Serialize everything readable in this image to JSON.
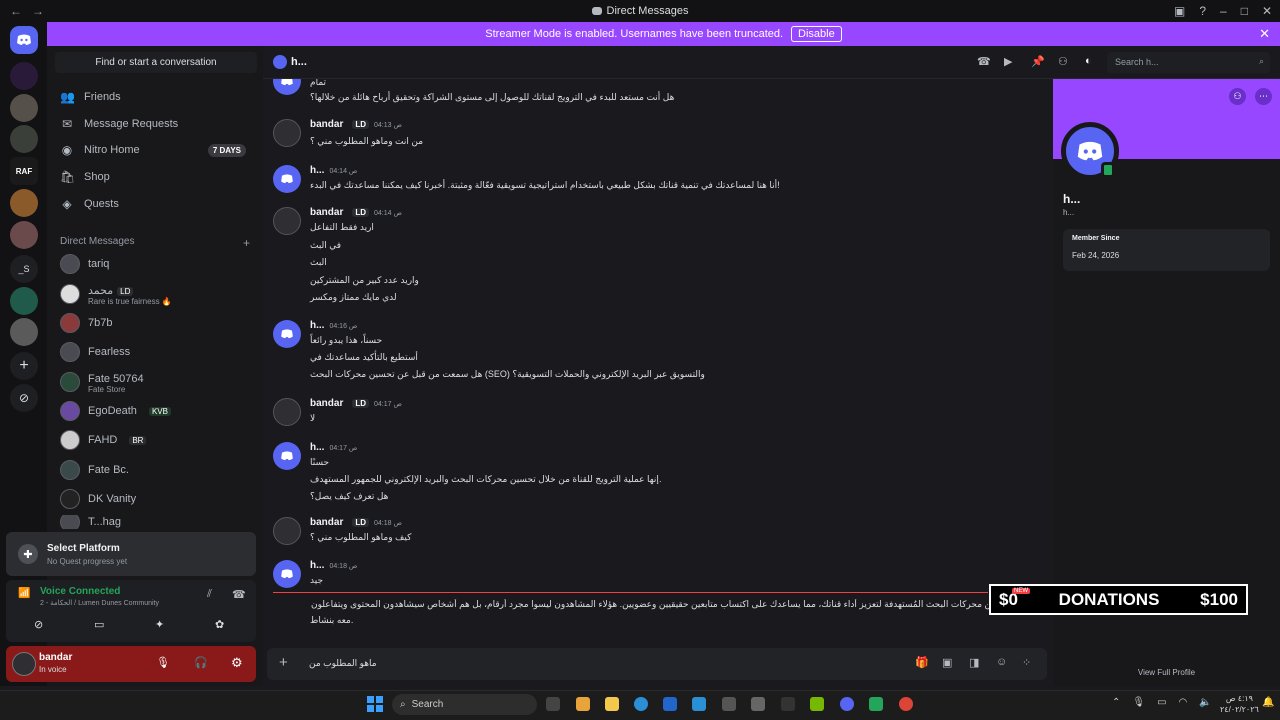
{
  "titlebar": {
    "title": "Direct Messages"
  },
  "banner": {
    "text": "Streamer Mode is enabled. Usernames have been truncated.",
    "button": "Disable"
  },
  "sidebar": {
    "find_placeholder": "Find or start a conversation",
    "nav": [
      {
        "label": "Friends",
        "icon": "friends-icon"
      },
      {
        "label": "Message Requests",
        "icon": "mail-icon"
      },
      {
        "label": "Nitro Home",
        "icon": "nitro-icon",
        "badge": "7 DAYS"
      },
      {
        "label": "Shop",
        "icon": "shop-icon"
      },
      {
        "label": "Quests",
        "icon": "quests-icon"
      }
    ],
    "dm_header": "Direct Messages",
    "dms": [
      {
        "name": "tariq",
        "sub": "",
        "tag": ""
      },
      {
        "name": "محمد",
        "sub": "Rare is true fairness 🔥",
        "tag": "LD"
      },
      {
        "name": "7b7b",
        "sub": "",
        "tag": ""
      },
      {
        "name": "Fearless",
        "sub": "",
        "tag": ""
      },
      {
        "name": "Fate 50764",
        "sub": "Fate Store",
        "tag": ""
      },
      {
        "name": "EgoDeath",
        "sub": "",
        "tag": "KVB"
      },
      {
        "name": "FAHD",
        "sub": "",
        "tag": "BR"
      },
      {
        "name": "Fate Bc.",
        "sub": "",
        "tag": ""
      },
      {
        "name": "DK Vanity",
        "sub": "",
        "tag": ""
      },
      {
        "name": "T...hag",
        "sub": "",
        "tag": ""
      }
    ]
  },
  "quest": {
    "title": "Select Platform",
    "sub": "No Quest progress yet"
  },
  "voice": {
    "status": "Voice Connected",
    "channel": "2 - الحكامة / Lumen Dunes Community"
  },
  "user": {
    "name": "bandar",
    "status": "In voice"
  },
  "chat_header": {
    "name": "h...",
    "search_placeholder": "Search h..."
  },
  "messages": [
    {
      "author": "",
      "time": "",
      "kind": "bot",
      "lines": [
        "تمام",
        "هل أنت مستعد للبدء في الترويج لقناتك للوصول إلى مستوى الشراكة وتحقيق أرباح هائلة من خلالها؟"
      ]
    },
    {
      "author": "bandar",
      "time": "04:13 ص",
      "kind": "user",
      "tag": "LD",
      "lines": [
        "من انت وماهو المطلوب مني ؟"
      ]
    },
    {
      "author": "h...",
      "time": "04:14 ص",
      "kind": "bot",
      "lines": [
        "أنا هنا لمساعدتك في تنمية قناتك بشكل طبيعي باستخدام استراتيجية تسويقية فعّالة ومثبتة. أخبرنا كيف يمكننا مساعدتك في البدء!"
      ]
    },
    {
      "author": "bandar",
      "time": "04:14 ص",
      "kind": "user",
      "tag": "LD",
      "lines": [
        "اريد فقط التفاعل",
        "في البث",
        "البث",
        "واريد عدد كبير من المشتركين",
        "لدي مايك ممتاز ومكسر"
      ]
    },
    {
      "author": "h...",
      "time": "04:16 ص",
      "kind": "bot",
      "lines": [
        "حسناً، هذا يبدو رائعاً",
        "أستطيع بالتأكيد مساعدتك في",
        "هل سمعت من قبل عن تحسين محركات البحث (SEO) والتسويق عبر البريد الإلكتروني والحملات التسويقية؟"
      ]
    },
    {
      "author": "bandar",
      "time": "04:17 ص",
      "kind": "user",
      "tag": "LD",
      "lines": [
        "لا"
      ]
    },
    {
      "author": "h...",
      "time": "04:17 ص",
      "kind": "bot",
      "lines": [
        "حسنًا",
        "إنها عملية الترويج للقناة من خلال تحسين محركات البحث والبريد الإلكتروني للجمهور المستهدف.",
        "هل تعرف كيف يصل؟"
      ]
    },
    {
      "author": "bandar",
      "time": "04:18 ص",
      "kind": "user",
      "tag": "LD",
      "lines": [
        "كيف وماهو المطلوب مني ؟"
      ]
    },
    {
      "author": "h...",
      "time": "04:18 ص",
      "kind": "bot",
      "lines": [
        "جيد",
        "نستخدم استراتيجيات تحسين محركات البحث المُستهدفة لتعزيز أداء قناتك، مما يساعدك على اكتساب متابعين حقيقيين وعضويين. هؤلاء المشاهدون ليسوا مجرد أرقام، بل هم أشخاص سيشاهدون المحتوى ويتفاعلون",
        "معه بنشاط."
      ]
    }
  ],
  "composer": {
    "value": "ماهو المطلوب من"
  },
  "profile": {
    "name": "h...",
    "sub": "h...",
    "member_label": "Member Since",
    "member_date": "Feb 24, 2026",
    "view_full": "View Full Profile"
  },
  "donation": {
    "left": "$0",
    "new_badge": "NEW",
    "label": "DONATIONS",
    "right": "$100"
  },
  "taskbar": {
    "search": "Search",
    "time": "٤:١٩ ص",
    "date": "٢٤/٠٢/٢٠٢٦"
  },
  "colors": {
    "accent": "#9747ff",
    "blurple": "#5865f2",
    "green": "#23a55a",
    "red": "#f23f43"
  }
}
